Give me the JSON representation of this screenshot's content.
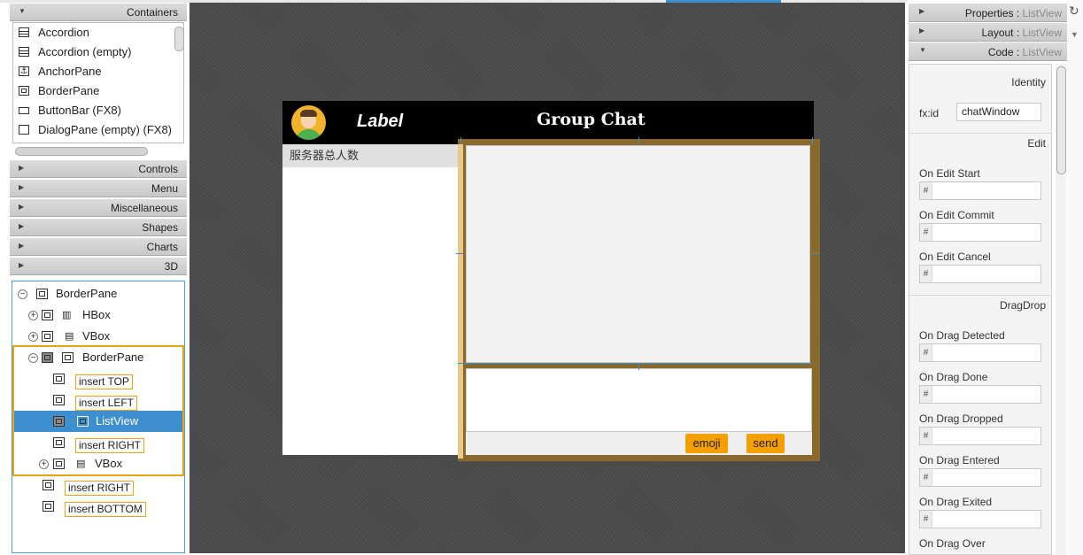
{
  "library": {
    "header": "Containers",
    "items": [
      "Accordion",
      "Accordion  (empty)",
      "AnchorPane",
      "BorderPane",
      "ButtonBar  (FX8)",
      "DialogPane (empty)  (FX8)"
    ],
    "sections": [
      "Controls",
      "Menu",
      "Miscellaneous",
      "Shapes",
      "Charts",
      "3D"
    ]
  },
  "hierarchy": {
    "root": "BorderPane",
    "hbox": "HBox",
    "vbox": "VBox",
    "inner_borderpane": "BorderPane",
    "insert_top": "insert TOP",
    "insert_left": "insert LEFT",
    "listview": "ListView",
    "insert_right": "insert RIGHT",
    "inner_vbox": "VBox",
    "outer_insert_right": "insert RIGHT",
    "outer_insert_bottom": "insert BOTTOM"
  },
  "preview": {
    "label": "Label",
    "title": "Group Chat",
    "server_count": "服务器总人数",
    "emoji_button": "emoji",
    "send_button": "send"
  },
  "inspector": {
    "properties_header": "Properties",
    "layout_header": "Layout",
    "code_header": "Code",
    "selected_type": "ListView",
    "identity_section": "Identity",
    "fxid_label": "fx:id",
    "fxid_value": "chatWindow",
    "edit_section": "Edit",
    "dragdrop_section": "DragDrop",
    "hash": "#",
    "fields": {
      "on_edit_start": "On Edit Start",
      "on_edit_commit": "On Edit Commit",
      "on_edit_cancel": "On Edit Cancel",
      "on_drag_detected": "On Drag Detected",
      "on_drag_done": "On Drag Done",
      "on_drag_dropped": "On Drag Dropped",
      "on_drag_entered": "On Drag Entered",
      "on_drag_exited": "On Drag Exited",
      "on_drag_over": "On Drag Over"
    }
  },
  "colors": {
    "accent_orange": "#f5a000",
    "selection_blue": "#3d8fcf",
    "header_black": "#000000"
  }
}
